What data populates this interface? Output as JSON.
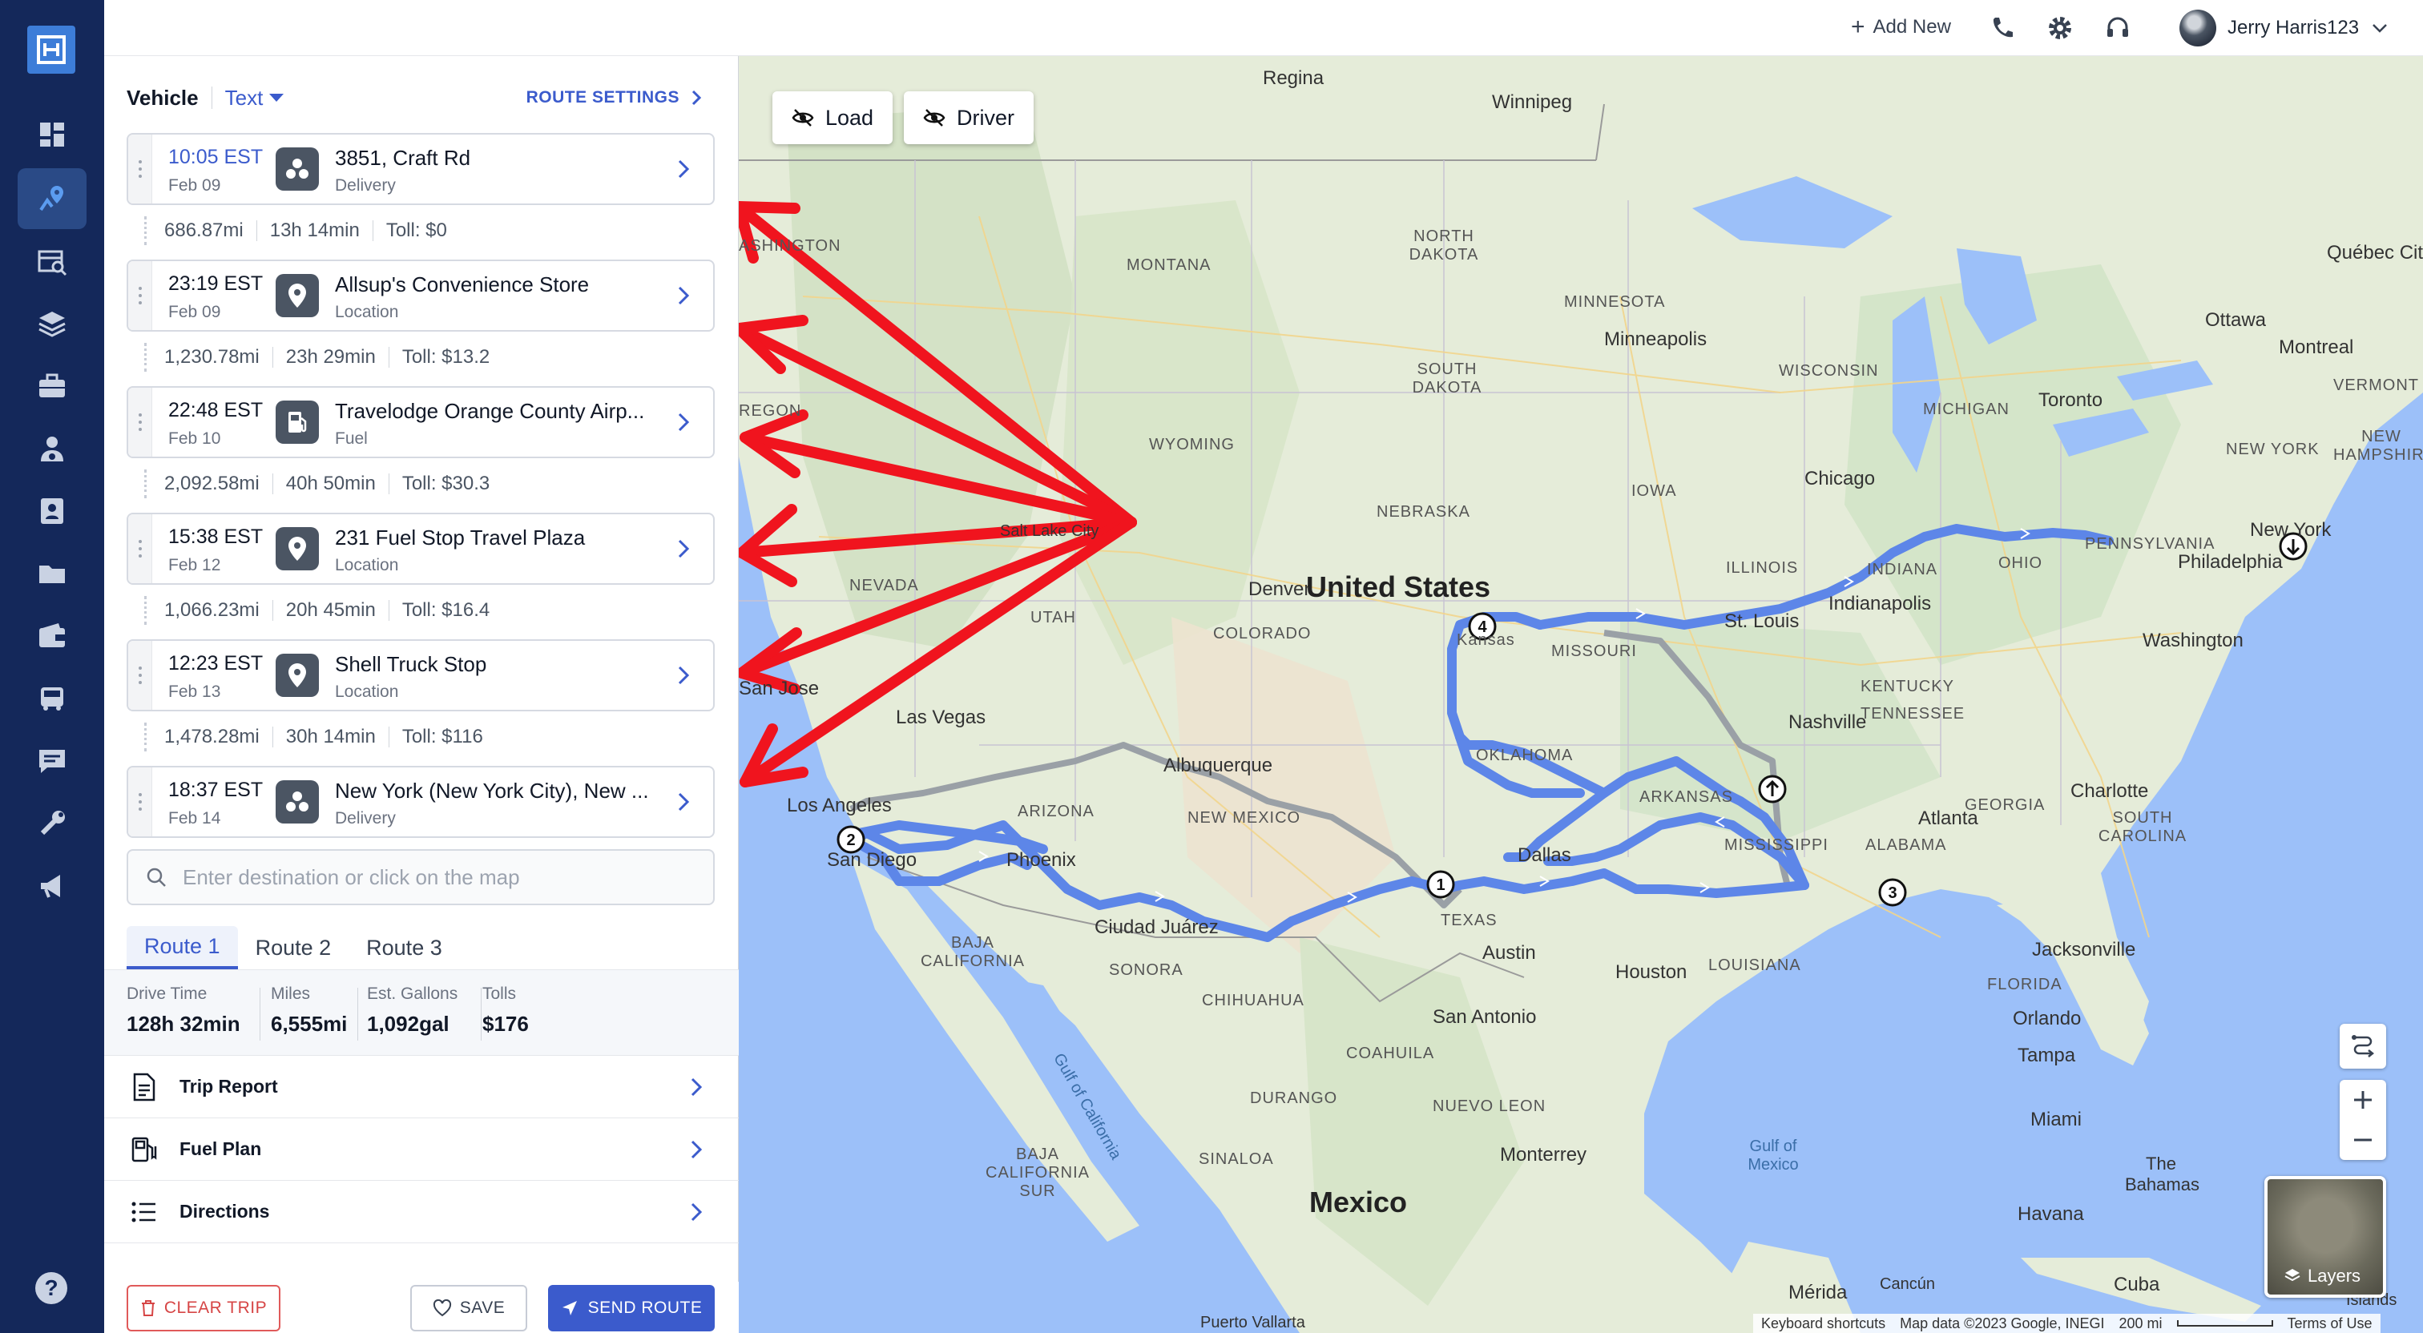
{
  "topbar": {
    "add_new": "Add New",
    "user_name": "Jerry Harris123",
    "icons": [
      "phone-icon",
      "gear-icon",
      "headset-icon"
    ]
  },
  "nav": {
    "icons": [
      "dashboard-icon",
      "route-planner-icon",
      "load-search-icon",
      "layers-icon",
      "briefcase-icon",
      "driver-icon",
      "contacts-icon",
      "folder-icon",
      "wallet-icon",
      "truck-icon",
      "chat-icon",
      "tools-icon",
      "megaphone-icon"
    ],
    "help": "?"
  },
  "panel": {
    "vehicle_label": "Vehicle",
    "vehicle_value": "Text",
    "route_settings": "ROUTE SETTINGS",
    "stops": [
      {
        "time": "10:05 EST",
        "date": "Feb 09",
        "name": "3851, Craft Rd",
        "type": "Delivery",
        "icon": "delivery-icon"
      },
      {
        "time": "23:19 EST",
        "date": "Feb 09",
        "name": "Allsup's Convenience Store",
        "type": "Location",
        "icon": "location-pin-icon"
      },
      {
        "time": "22:48 EST",
        "date": "Feb 10",
        "name": "Travelodge Orange County Airp...",
        "type": "Fuel",
        "icon": "fuel-icon"
      },
      {
        "time": "15:38 EST",
        "date": "Feb 12",
        "name": "231 Fuel Stop Travel Plaza",
        "type": "Location",
        "icon": "location-pin-icon"
      },
      {
        "time": "12:23 EST",
        "date": "Feb 13",
        "name": "Shell Truck Stop",
        "type": "Location",
        "icon": "location-pin-icon"
      },
      {
        "time": "18:37 EST",
        "date": "Feb 14",
        "name": "New York (New York City), New ...",
        "type": "Delivery",
        "icon": "delivery-icon"
      }
    ],
    "legs": [
      {
        "miles": "686.87mi",
        "time": "13h 14min",
        "toll": "Toll: $0"
      },
      {
        "miles": "1,230.78mi",
        "time": "23h 29min",
        "toll": "Toll: $13.2"
      },
      {
        "miles": "2,092.58mi",
        "time": "40h 50min",
        "toll": "Toll: $30.3"
      },
      {
        "miles": "1,066.23mi",
        "time": "20h 45min",
        "toll": "Toll: $16.4"
      },
      {
        "miles": "1,478.28mi",
        "time": "30h 14min",
        "toll": "Toll: $116"
      }
    ],
    "search_placeholder": "Enter destination or click on the map",
    "tabs": [
      "Route 1",
      "Route 2",
      "Route 3"
    ],
    "active_tab": "Route 1",
    "stats": [
      {
        "label": "Drive Time",
        "value": "128h 32min"
      },
      {
        "label": "Miles",
        "value": "6,555mi"
      },
      {
        "label": "Est. Gallons",
        "value": "1,092gal"
      },
      {
        "label": "Tolls",
        "value": "$176"
      }
    ],
    "menu": [
      {
        "label": "Trip Report",
        "icon": "document-icon"
      },
      {
        "label": "Fuel Plan",
        "icon": "fuel-pump-icon"
      },
      {
        "label": "Directions",
        "icon": "list-icon"
      }
    ],
    "buttons": {
      "clear": "CLEAR TRIP",
      "save": "SAVE",
      "send": "SEND ROUTE"
    }
  },
  "map": {
    "toggles": {
      "load": "Load",
      "driver": "Driver"
    },
    "labels": {
      "country_us": "United States",
      "country_mx": "Mexico",
      "cities": [
        "Regina",
        "Winnipeg",
        "Minneapolis",
        "Ottawa",
        "Montreal",
        "Québec City",
        "Toronto",
        "Chicago",
        "Denver",
        "Salt Lake City",
        "Las Vegas",
        "Los Angeles",
        "San Diego",
        "San Jose",
        "Phoenix",
        "Albuquerque",
        "Ciudad Juárez",
        "Dallas",
        "Austin",
        "Houston",
        "San Antonio",
        "Nashville",
        "Atlanta",
        "Charlotte",
        "Indianapolis",
        "St. Louis",
        "Philadelphia",
        "New York",
        "Washington",
        "Jacksonville",
        "Orlando",
        "Tampa",
        "Miami",
        "Monterrey",
        "Havana",
        "Mérida",
        "Cancún",
        "Puerto Vallarta",
        "Kansas"
      ],
      "states": [
        "MONTANA",
        "NORTH DAKOTA",
        "SOUTH DAKOTA",
        "MINNESOTA",
        "WYOMING",
        "NEBRASKA",
        "IOWA",
        "WISCONSIN",
        "MICHIGAN",
        "ILLINOIS",
        "INDIANA",
        "OHIO",
        "PENNSYLVANIA",
        "NEW YORK",
        "VERMONT",
        "NEW HAMPSHIRE",
        "NEVADA",
        "UTAH",
        "COLORADO",
        "MISSOURI",
        "KENTUCKY",
        "TENNESSEE",
        "OKLAHOMA",
        "ARKANSAS",
        "MISSISSIPPI",
        "ALABAMA",
        "GEORGIA",
        "SOUTH CAROLINA",
        "ARIZONA",
        "NEW MEXICO",
        "TEXAS",
        "LOUISIANA",
        "FLORIDA",
        "BAJA CALIFORNIA",
        "SONORA",
        "CHIHUAHUA",
        "COAHUILA",
        "NUEVO LEON",
        "SINALOA",
        "BAJA CALIFORNIA SUR",
        "DURANGO",
        "ASHINGTON",
        "REGON"
      ],
      "water": [
        "Gulf of California",
        "Gulf of Mexico",
        "The Bahamas",
        "Cuba",
        "Islands"
      ]
    },
    "waypoints": [
      "1",
      "2",
      "3",
      "4"
    ],
    "layers_label": "Layers",
    "attribution": {
      "shortcuts": "Keyboard shortcuts",
      "data": "Map data ©2023 Google, INEGI",
      "scale": "200 mi",
      "terms": "Terms of Use"
    }
  }
}
